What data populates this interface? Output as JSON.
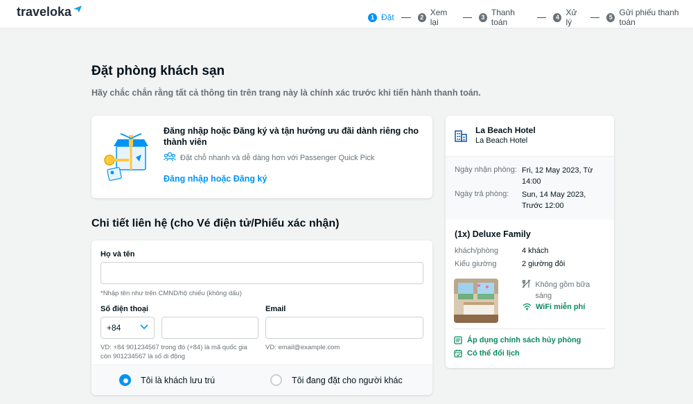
{
  "brand": {
    "name": "traveloka"
  },
  "steps": [
    {
      "num": "1",
      "label": "Đặt",
      "active": true
    },
    {
      "num": "2",
      "label": "Xem lại"
    },
    {
      "num": "3",
      "label": "Thanh toán"
    },
    {
      "num": "4",
      "label": "Xử lý"
    },
    {
      "num": "5",
      "label": "Gửi phiếu thanh toán"
    }
  ],
  "page": {
    "title": "Đặt phòng khách sạn",
    "subtitle": "Hãy chắc chắn rằng tất cả thông tin trên trang này là chính xác trước khi tiến hành thanh toán."
  },
  "login": {
    "title": "Đăng nhập hoặc Đăng ký và tận hưởng ưu đãi dành riêng cho thành viên",
    "subtitle": "Đặt chỗ nhanh và dễ dàng hơn với Passenger Quick Pick",
    "link": "Đăng nhập hoặc Đăng ký"
  },
  "contact": {
    "title": "Chi tiết liên hệ (cho Vé điện tử/Phiếu xác nhận)",
    "name_label": "Họ và tên",
    "name_value": "",
    "name_hint": "*Nhập tên như trên CMND/hộ chiếu (không dấu)",
    "phone_label": "Số điện thoại",
    "country_code": "+84",
    "phone_value": "",
    "phone_hint_1": "VD: +84 901234567 trong đó (+84) là mã quốc gia",
    "phone_hint_2": "còn 901234567 là số di động",
    "email_label": "Email",
    "email_value": "",
    "email_hint": "VD: email@example.com",
    "radio_self": "Tôi là khách lưu trú",
    "radio_other": "Tôi đang đặt cho người khác"
  },
  "hotel": {
    "name": "La Beach Hotel",
    "name_sub": "La Beach Hotel",
    "checkin_label": "Ngày nhận phòng:",
    "checkin_value": "Fri, 12 May 2023, Từ 14:00",
    "checkout_label": "Ngày trả phòng:",
    "checkout_value": "Sun, 14 May 2023, Trước 12:00",
    "room_title": "(1x) Deluxe Family",
    "guests_label": "khách/phòng",
    "guests_value": "4 khách",
    "bed_label": "Kiểu giường",
    "bed_value": "2 giường đôi",
    "breakfast": "Không gồm bữa sáng",
    "wifi": "WiFi miễn phí",
    "policy_cancel": "Áp dụng chính sách hủy phòng",
    "policy_reschedule": "Có thể đổi lịch"
  },
  "colors": {
    "accent": "#0194f3",
    "green": "#0a8a5f",
    "text": "#03121a",
    "muted": "#687176"
  }
}
